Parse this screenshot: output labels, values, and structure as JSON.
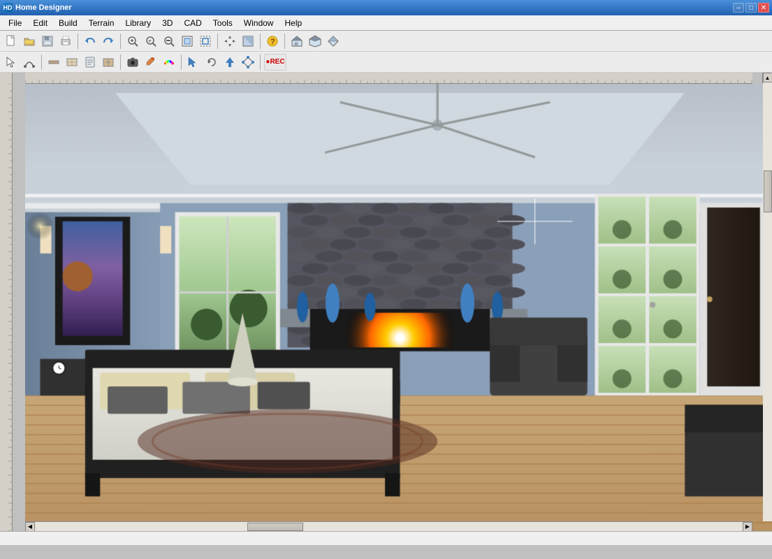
{
  "app": {
    "title": "Home Designer",
    "icon": "HD"
  },
  "title_controls": {
    "minimize": "–",
    "maximize": "□",
    "close": "✕"
  },
  "menu": {
    "items": [
      {
        "label": "File",
        "id": "file"
      },
      {
        "label": "Edit",
        "id": "edit"
      },
      {
        "label": "Build",
        "id": "build"
      },
      {
        "label": "Terrain",
        "id": "terrain"
      },
      {
        "label": "Library",
        "id": "library"
      },
      {
        "label": "3D",
        "id": "3d"
      },
      {
        "label": "CAD",
        "id": "cad"
      },
      {
        "label": "Tools",
        "id": "tools"
      },
      {
        "label": "Window",
        "id": "window"
      },
      {
        "label": "Help",
        "id": "help"
      }
    ]
  },
  "toolbar1": {
    "buttons": [
      {
        "id": "new",
        "icon": "new-icon",
        "title": "New"
      },
      {
        "id": "open",
        "icon": "open-icon",
        "title": "Open"
      },
      {
        "id": "save",
        "icon": "save-icon",
        "title": "Save"
      },
      {
        "id": "print",
        "icon": "print-icon",
        "title": "Print"
      },
      {
        "id": "undo",
        "icon": "undo-icon",
        "title": "Undo"
      },
      {
        "id": "redo",
        "icon": "redo-icon",
        "title": "Redo"
      },
      {
        "id": "zoom-in-icon-btn",
        "icon": "zoom-in-icon",
        "title": "Zoom In"
      },
      {
        "id": "zoom-in2",
        "icon": "zoom-in2-icon",
        "title": "Zoom In"
      },
      {
        "id": "zoom-out",
        "icon": "zoom-out-icon",
        "title": "Zoom Out"
      },
      {
        "id": "zoom-fit",
        "icon": "zoom-fit-icon",
        "title": "Fit"
      },
      {
        "id": "zoom-box",
        "icon": "zoom-box-icon",
        "title": "Zoom Box"
      },
      {
        "id": "plan-view",
        "icon": "plan-view-icon",
        "title": "Plan View"
      },
      {
        "id": "arrows",
        "icon": "arrows-icon",
        "title": "Pan"
      },
      {
        "id": "fill",
        "icon": "fill-icon",
        "title": "Fill"
      },
      {
        "id": "question",
        "icon": "question-icon",
        "title": "Help"
      },
      {
        "id": "house1",
        "icon": "house1-icon",
        "title": "House 1"
      },
      {
        "id": "house2",
        "icon": "house2-icon",
        "title": "House 2"
      },
      {
        "id": "house3",
        "icon": "house3-icon",
        "title": "House 3"
      }
    ]
  },
  "toolbar2": {
    "buttons": [
      {
        "id": "select",
        "icon": "select-icon",
        "title": "Select"
      },
      {
        "id": "curve",
        "icon": "curve-icon",
        "title": "Curve"
      },
      {
        "id": "wall",
        "icon": "wall-icon",
        "title": "Wall"
      },
      {
        "id": "floor",
        "icon": "floor-icon",
        "title": "Floor"
      },
      {
        "id": "save2",
        "icon": "save2-icon",
        "title": "Save"
      },
      {
        "id": "cabinet",
        "icon": "cabinet-icon",
        "title": "Cabinet"
      },
      {
        "id": "stairs",
        "icon": "stairs-icon",
        "title": "Stairs"
      },
      {
        "id": "camera",
        "icon": "camera-icon",
        "title": "Camera"
      },
      {
        "id": "paint",
        "icon": "paint-icon",
        "title": "Paint"
      },
      {
        "id": "rainbow",
        "icon": "rainbow-icon",
        "title": "Material"
      },
      {
        "id": "pointer2",
        "icon": "pointer2-icon",
        "title": "Pointer 2"
      },
      {
        "id": "rotate",
        "icon": "rotate-icon",
        "title": "Rotate"
      },
      {
        "id": "up-arrow",
        "icon": "up-arrow-icon",
        "title": "Up"
      },
      {
        "id": "transform",
        "icon": "transform-icon",
        "title": "Transform"
      },
      {
        "id": "rec",
        "icon": "rec-icon",
        "title": "Record"
      }
    ]
  },
  "scene": {
    "description": "3D bedroom interior view with fireplace, bed, and windows",
    "bg_color": "#7a96b0"
  },
  "status_bar": {
    "text": ""
  },
  "scrollbars": {
    "vertical": true,
    "horizontal": true
  }
}
